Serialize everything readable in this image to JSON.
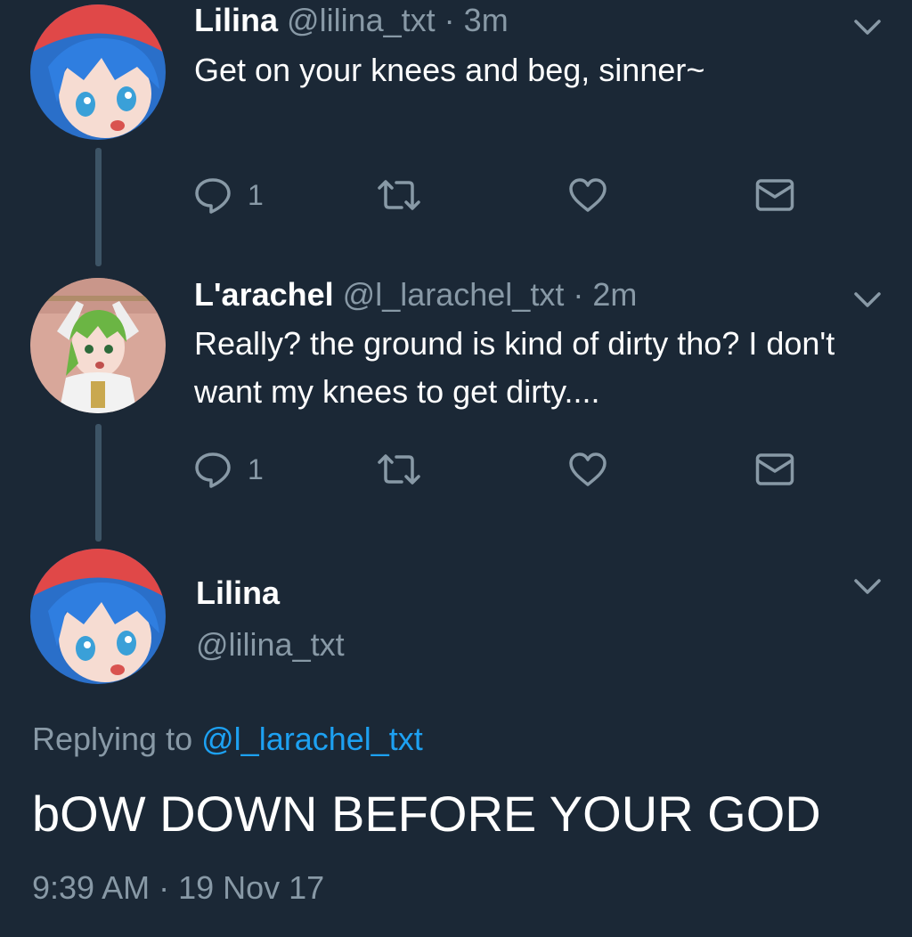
{
  "tweets": [
    {
      "name": "Lilina",
      "handle": "@lilina_txt",
      "separator": "·",
      "time": "3m",
      "text": "Get on your knees and beg, sinner~",
      "reply_count": "1"
    },
    {
      "name": "L'arachel",
      "handle": "@l_larachel_txt",
      "separator": "·",
      "time": "2m",
      "text": "Really? the ground is kind of dirty tho? I don't want my knees to get dirty....",
      "reply_count": "1"
    }
  ],
  "main_tweet": {
    "name": "Lilina",
    "handle": "@lilina_txt",
    "replying_prefix": "Replying to",
    "replying_mention": "@l_larachel_txt",
    "text": "bOW DOWN BEFORE YOUR GOD",
    "timestamp": "9:39 AM · 19 Nov 17"
  },
  "icons": {
    "reply": "reply-icon",
    "retweet": "retweet-icon",
    "like": "heart-icon",
    "dm": "envelope-icon",
    "menu": "chevron-down-icon"
  },
  "colors": {
    "background": "#1b2836",
    "text_primary": "#ffffff",
    "text_secondary": "#8899a6",
    "link": "#1da1f2",
    "thread_line": "#3d5466"
  }
}
